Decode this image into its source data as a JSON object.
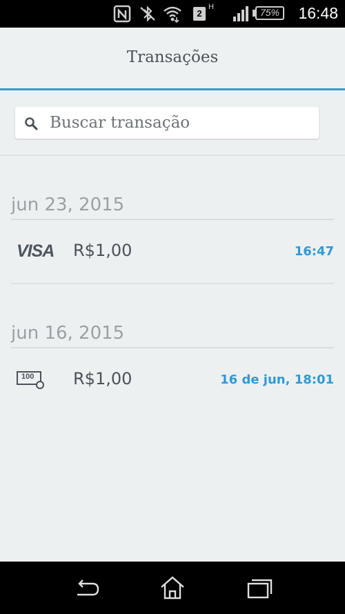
{
  "status_bar": {
    "time": "16:48",
    "battery": "75%",
    "sim_badge": "2",
    "network_label": "H",
    "icons": [
      "nfc-icon",
      "bluetooth-icon",
      "wifi-icon",
      "sim-icon",
      "signal-icon",
      "battery-icon"
    ]
  },
  "header": {
    "title": "Transações"
  },
  "search": {
    "placeholder": "Buscar transação",
    "value": ""
  },
  "groups": [
    {
      "date": "jun 23, 2015",
      "transactions": [
        {
          "brand": "VISA",
          "brand_icon": "visa-logo",
          "amount": "R$1,00",
          "time": "16:47"
        }
      ]
    },
    {
      "date": "jun 16, 2015",
      "transactions": [
        {
          "brand_icon": "cash-bill-icon",
          "brand_badge": "100",
          "amount": "R$1,00",
          "time": "16 de jun, 18:01"
        }
      ]
    }
  ],
  "colors": {
    "accent": "#2e9ad6",
    "background": "#edf0f1",
    "text": "#4a5158",
    "muted": "#9aa0a5"
  },
  "nav_bar": {
    "buttons": [
      "back-icon",
      "home-icon",
      "recents-icon"
    ]
  }
}
